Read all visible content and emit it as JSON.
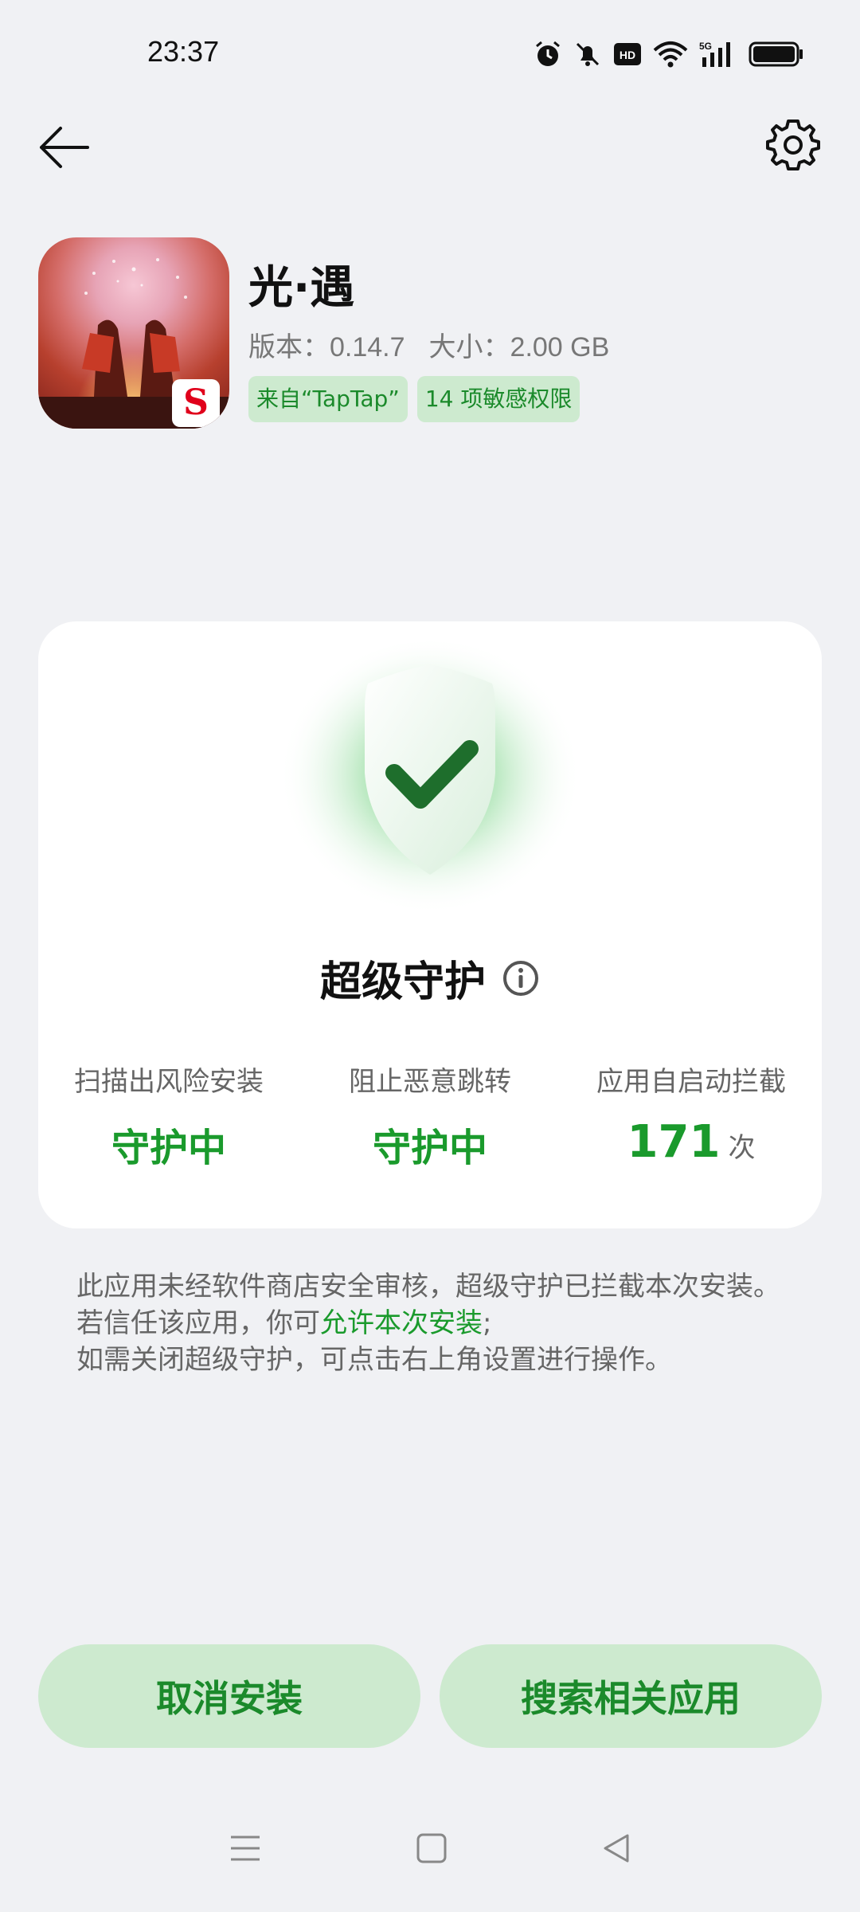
{
  "status_bar": {
    "time": "23:37",
    "icons": [
      "alarm-icon",
      "mute-icon",
      "hd-icon",
      "wifi-icon",
      "5g-signal-icon",
      "battery-icon"
    ]
  },
  "top_bar": {
    "back_icon": "arrow-left-icon",
    "settings_icon": "gear-icon"
  },
  "app": {
    "name": "光·遇",
    "version_label": "版本：0.14.7",
    "size_label": "大小：2.00 GB",
    "tags": [
      "来自“TapTap”",
      "14 项敏感权限"
    ]
  },
  "protection": {
    "title": "超级守护",
    "stats": [
      {
        "label": "扫描出风险安装",
        "value": "守护中"
      },
      {
        "label": "阻止恶意跳转",
        "value": "守护中"
      },
      {
        "label": "应用自启动拦截",
        "value": "171",
        "unit": "次"
      }
    ]
  },
  "description": {
    "part1": "此应用未经软件商店安全审核，超级守护已拦截本次安装。若信任该应用，你可",
    "link": "允许本次安装",
    "part2": ";",
    "line3": "如需关闭超级守护，可点击右上角设置进行操作。"
  },
  "buttons": {
    "cancel": "取消安装",
    "search": "搜索相关应用"
  },
  "colors": {
    "accent": "#1a9a2c",
    "tag_bg": "#cdeacf",
    "page_bg": "#f0f1f4"
  }
}
